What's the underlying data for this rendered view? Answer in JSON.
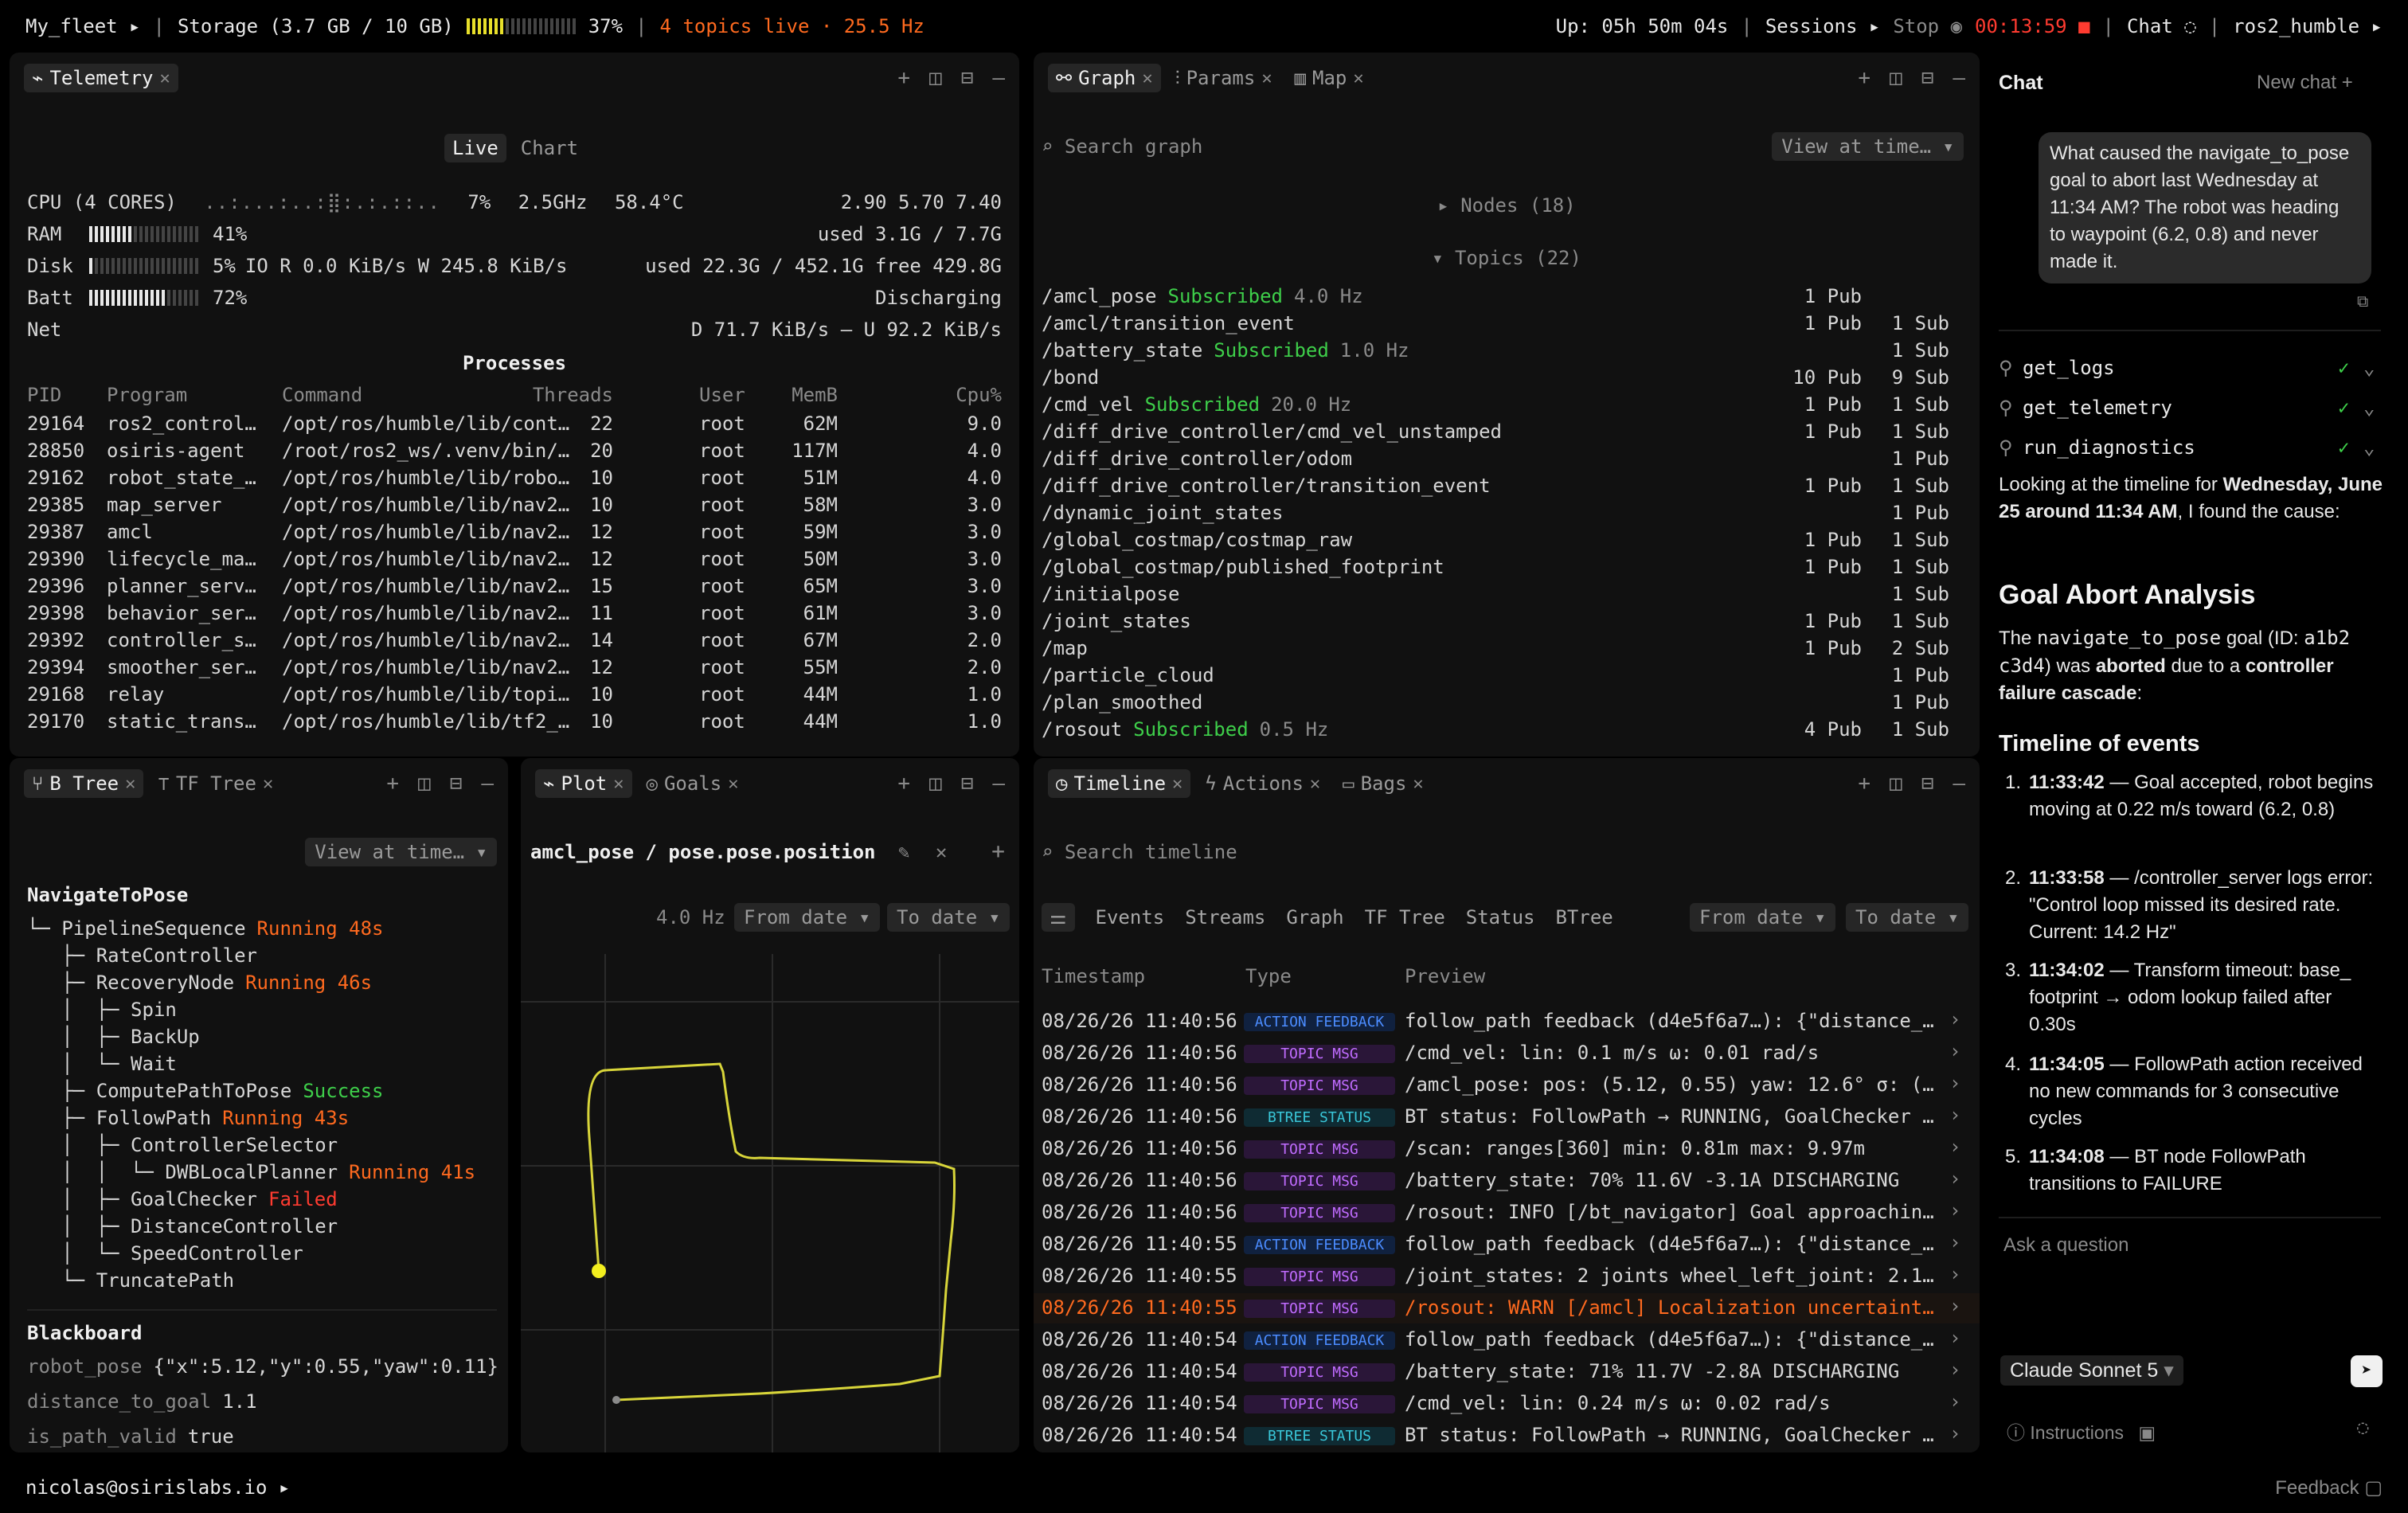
{
  "topbar": {
    "fleet": "My_fleet",
    "storage": "Storage (3.7 GB / 10 GB)",
    "storage_pct": "37%",
    "storage_fraction": 0.37,
    "topics_live": "4 topics live · 25.5 Hz",
    "uptime": "Up: 05h 50m 04s",
    "sessions": "Sessions",
    "stop": "Stop",
    "timer": "00:13:59",
    "chat": "Chat",
    "robot": "ros2_humble"
  },
  "telemetry": {
    "tab": "Telemetry",
    "mode_live": "Live",
    "mode_chart": "Chart",
    "cpu_label": "CPU (4 CORES)",
    "cpu_spark": "..:...:..:⣿:.:.::..",
    "cpu_pct": "7%",
    "cpu_freq": "2.5GHz",
    "cpu_temp": "58.4°C",
    "cpu_load": "2.90 5.70 7.40",
    "ram_label": "RAM",
    "ram_pct": "41%",
    "ram_fraction": 0.41,
    "ram_used": "used 3.1G / 7.7G",
    "disk_label": "Disk",
    "disk_pct": "5%",
    "disk_fraction": 0.05,
    "disk_io": "IO R 0.0 KiB/s W 245.8 KiB/s",
    "disk_used": "used 22.3G / 452.1G free 429.8G",
    "batt_label": "Batt",
    "batt_pct": "72%",
    "batt_fraction": 0.72,
    "batt_state": "Discharging",
    "net_label": "Net",
    "net_rate": "D 71.7 KiB/s — U 92.2 KiB/s",
    "processes_title": "Processes",
    "columns": [
      "PID",
      "Program",
      "Command",
      "Threads",
      "User",
      "MemB",
      "Cpu%"
    ],
    "processes": [
      [
        "29164",
        "ros2_control…",
        "/opt/ros/humble/lib/cont…",
        "22",
        "root",
        "62M",
        "9.0"
      ],
      [
        "28850",
        "osiris-agent",
        "/root/ros2_ws/.venv/bin/…",
        "20",
        "root",
        "117M",
        "4.0"
      ],
      [
        "29162",
        "robot_state_…",
        "/opt/ros/humble/lib/robo…",
        "10",
        "root",
        "51M",
        "4.0"
      ],
      [
        "29385",
        "map_server",
        "/opt/ros/humble/lib/nav2…",
        "10",
        "root",
        "58M",
        "3.0"
      ],
      [
        "29387",
        "amcl",
        "/opt/ros/humble/lib/nav2…",
        "12",
        "root",
        "59M",
        "3.0"
      ],
      [
        "29390",
        "lifecycle_ma…",
        "/opt/ros/humble/lib/nav2…",
        "12",
        "root",
        "50M",
        "3.0"
      ],
      [
        "29396",
        "planner_serv…",
        "/opt/ros/humble/lib/nav2…",
        "15",
        "root",
        "65M",
        "3.0"
      ],
      [
        "29398",
        "behavior_ser…",
        "/opt/ros/humble/lib/nav2…",
        "11",
        "root",
        "61M",
        "3.0"
      ],
      [
        "29392",
        "controller_s…",
        "/opt/ros/humble/lib/nav2…",
        "14",
        "root",
        "67M",
        "2.0"
      ],
      [
        "29394",
        "smoother_ser…",
        "/opt/ros/humble/lib/nav2…",
        "12",
        "root",
        "55M",
        "2.0"
      ],
      [
        "29168",
        "relay",
        "/opt/ros/humble/lib/topi…",
        "10",
        "root",
        "44M",
        "1.0"
      ],
      [
        "29170",
        "static_trans…",
        "/opt/ros/humble/lib/tf2_…",
        "10",
        "root",
        "44M",
        "1.0"
      ]
    ]
  },
  "graph": {
    "tabs": [
      "Graph",
      "Params",
      "Map"
    ],
    "search_placeholder": "Search graph",
    "view_at_time": "View at time…",
    "nodes": "Nodes (18)",
    "topics": "Topics (22)",
    "topic_rows": [
      {
        "name": "/amcl_pose",
        "status": "Subscribed",
        "hz": "4.0 Hz",
        "pub": "1 Pub",
        "sub": ""
      },
      {
        "name": "/amcl/transition_event",
        "status": "",
        "hz": "",
        "pub": "1 Pub",
        "sub": "1 Sub"
      },
      {
        "name": "/battery_state",
        "status": "Subscribed",
        "hz": "1.0 Hz",
        "pub": "",
        "sub": "1 Sub"
      },
      {
        "name": "/bond",
        "status": "",
        "hz": "",
        "pub": "10 Pub",
        "sub": "9 Sub"
      },
      {
        "name": "/cmd_vel",
        "status": "Subscribed",
        "hz": "20.0 Hz",
        "pub": "1 Pub",
        "sub": "1 Sub"
      },
      {
        "name": "/diff_drive_controller/cmd_vel_unstamped",
        "status": "",
        "hz": "",
        "pub": "1 Pub",
        "sub": "1 Sub"
      },
      {
        "name": "/diff_drive_controller/odom",
        "status": "",
        "hz": "",
        "pub": "",
        "sub": "1 Pub"
      },
      {
        "name": "/diff_drive_controller/transition_event",
        "status": "",
        "hz": "",
        "pub": "1 Pub",
        "sub": "1 Sub"
      },
      {
        "name": "/dynamic_joint_states",
        "status": "",
        "hz": "",
        "pub": "",
        "sub": "1 Pub"
      },
      {
        "name": "/global_costmap/costmap_raw",
        "status": "",
        "hz": "",
        "pub": "1 Pub",
        "sub": "1 Sub"
      },
      {
        "name": "/global_costmap/published_footprint",
        "status": "",
        "hz": "",
        "pub": "1 Pub",
        "sub": "1 Sub"
      },
      {
        "name": "/initialpose",
        "status": "",
        "hz": "",
        "pub": "",
        "sub": "1 Sub"
      },
      {
        "name": "/joint_states",
        "status": "",
        "hz": "",
        "pub": "1 Pub",
        "sub": "1 Sub"
      },
      {
        "name": "/map",
        "status": "",
        "hz": "",
        "pub": "1 Pub",
        "sub": "2 Sub"
      },
      {
        "name": "/particle_cloud",
        "status": "",
        "hz": "",
        "pub": "",
        "sub": "1 Pub"
      },
      {
        "name": "/plan_smoothed",
        "status": "",
        "hz": "",
        "pub": "",
        "sub": "1 Pub"
      },
      {
        "name": "/rosout",
        "status": "Subscribed",
        "hz": "0.5 Hz",
        "pub": "4 Pub",
        "sub": "1 Sub"
      }
    ]
  },
  "btree": {
    "tabs": [
      "B Tree",
      "TF Tree"
    ],
    "view_at_time": "View at time…",
    "root": "NavigateToPose",
    "lines": [
      {
        "prefix": "└─ ",
        "name": "PipelineSequence",
        "status": "Running 48s",
        "kind": "running"
      },
      {
        "prefix": "   ├─ ",
        "name": "RateController",
        "status": "",
        "kind": ""
      },
      {
        "prefix": "   ├─ ",
        "name": "RecoveryNode",
        "status": "Running 46s",
        "kind": "running"
      },
      {
        "prefix": "   │  ├─ ",
        "name": "Spin",
        "status": "",
        "kind": ""
      },
      {
        "prefix": "   │  ├─ ",
        "name": "BackUp",
        "status": "",
        "kind": ""
      },
      {
        "prefix": "   │  └─ ",
        "name": "Wait",
        "status": "",
        "kind": ""
      },
      {
        "prefix": "   ├─ ",
        "name": "ComputePathToPose",
        "status": "Success",
        "kind": "success"
      },
      {
        "prefix": "   ├─ ",
        "name": "FollowPath",
        "status": "Running 43s",
        "kind": "running"
      },
      {
        "prefix": "   │  ├─ ",
        "name": "ControllerSelector",
        "status": "",
        "kind": ""
      },
      {
        "prefix": "   │  │  └─ ",
        "name": "DWBLocalPlanner",
        "status": "Running 41s",
        "kind": "running"
      },
      {
        "prefix": "   │  ├─ ",
        "name": "GoalChecker",
        "status": "Failed",
        "kind": "failed"
      },
      {
        "prefix": "   │  ├─ ",
        "name": "DistanceController",
        "status": "",
        "kind": ""
      },
      {
        "prefix": "   │  └─ ",
        "name": "SpeedController",
        "status": "",
        "kind": ""
      },
      {
        "prefix": "   └─ ",
        "name": "TruncatePath",
        "status": "",
        "kind": ""
      }
    ],
    "blackboard_title": "Blackboard",
    "blackboard": [
      {
        "key": "robot_pose",
        "val": "{\"x\":5.12,\"y\":0.55,\"yaw\":0.11}"
      },
      {
        "key": "distance_to_goal",
        "val": "1.1"
      },
      {
        "key": "is_path_valid",
        "val": "true"
      }
    ]
  },
  "plot": {
    "tabs": [
      "Plot",
      "Goals"
    ],
    "title": "amcl_pose / pose.pose.position",
    "hz": "4.0 Hz",
    "from_date": "From date",
    "to_date": "To date"
  },
  "timeline": {
    "tabs": [
      "Timeline",
      "Actions",
      "Bags"
    ],
    "search_placeholder": "Search timeline",
    "filters": [
      "Events",
      "Streams",
      "Graph",
      "TF Tree",
      "Status",
      "BTree"
    ],
    "from_date": "From date",
    "to_date": "To date",
    "columns": [
      "Timestamp",
      "Type",
      "Preview"
    ],
    "rows": [
      {
        "ts": "08/26/26 11:40:56",
        "type": "ACTION FEEDBACK",
        "kind": "af",
        "preview": "follow_path feedback (d4e5f6a7…): {\"distance_…",
        "warn": false
      },
      {
        "ts": "08/26/26 11:40:56",
        "type": "TOPIC MSG",
        "kind": "tm",
        "preview": "/cmd_vel: lin: 0.1 m/s ω: 0.01 rad/s",
        "warn": false
      },
      {
        "ts": "08/26/26 11:40:56",
        "type": "TOPIC MSG",
        "kind": "tm",
        "preview": "/amcl_pose: pos: (5.12, 0.55) yaw: 12.6° σ: (…",
        "warn": false
      },
      {
        "ts": "08/26/26 11:40:56",
        "type": "BTREE STATUS",
        "kind": "bs",
        "preview": "BT status: FollowPath → RUNNING, GoalChecker …",
        "warn": false
      },
      {
        "ts": "08/26/26 11:40:56",
        "type": "TOPIC MSG",
        "kind": "tm",
        "preview": "/scan: ranges[360] min: 0.81m max: 9.97m",
        "warn": false
      },
      {
        "ts": "08/26/26 11:40:56",
        "type": "TOPIC MSG",
        "kind": "tm",
        "preview": "/battery_state: 70% 11.6V -3.1A DISCHARGING",
        "warn": false
      },
      {
        "ts": "08/26/26 11:40:56",
        "type": "TOPIC MSG",
        "kind": "tm",
        "preview": "/rosout: INFO [/bt_navigator] Goal approachin…",
        "warn": false
      },
      {
        "ts": "08/26/26 11:40:55",
        "type": "ACTION FEEDBACK",
        "kind": "af",
        "preview": "follow_path feedback (d4e5f6a7…): {\"distance_…",
        "warn": false
      },
      {
        "ts": "08/26/26 11:40:55",
        "type": "TOPIC MSG",
        "kind": "tm",
        "preview": "/joint_states: 2 joints wheel_left_joint: 2.1…",
        "warn": false
      },
      {
        "ts": "08/26/26 11:40:55",
        "type": "TOPIC MSG",
        "kind": "tm",
        "preview": "/rosout: WARN [/amcl] Localization uncertaint…",
        "warn": true
      },
      {
        "ts": "08/26/26 11:40:54",
        "type": "ACTION FEEDBACK",
        "kind": "af",
        "preview": "follow_path feedback (d4e5f6a7…): {\"distance_…",
        "warn": false
      },
      {
        "ts": "08/26/26 11:40:54",
        "type": "TOPIC MSG",
        "kind": "tm",
        "preview": "/battery_state: 71% 11.7V -2.8A DISCHARGING",
        "warn": false
      },
      {
        "ts": "08/26/26 11:40:54",
        "type": "TOPIC MSG",
        "kind": "tm",
        "preview": "/cmd_vel: lin: 0.24 m/s ω: 0.02 rad/s",
        "warn": false
      },
      {
        "ts": "08/26/26 11:40:54",
        "type": "BTREE STATUS",
        "kind": "bs",
        "preview": "BT status: FollowPath → RUNNING, GoalChecker …",
        "warn": false
      }
    ]
  },
  "chat": {
    "title": "Chat",
    "new_chat": "New chat",
    "user_message": "What caused the navigate_to_pose goal to abort last Wednesday at 11:34 AM? The robot was heading to waypoint (6.2, 0.8) and never made it.",
    "tools": [
      "get_logs",
      "get_telemetry",
      "run_diagnostics"
    ],
    "intro_a": "Looking at the timeline for ",
    "intro_b": "Wednesday, June 25 around 11:34 AM",
    "intro_c": ", I found the cause:",
    "heading": "Goal Abort Analysis",
    "summary_a": "The ",
    "summary_code1": "navigate_to_pose",
    "summary_b": " goal (ID: ",
    "summary_code2": "a1b2 c3d4",
    "summary_c": ") was ",
    "summary_d": "aborted",
    "summary_e": " due to a ",
    "summary_f": "controller failure cascade",
    "summary_g": ":",
    "timeline_heading": "Timeline of events",
    "events": [
      {
        "n": "1.",
        "t": "11:33:42",
        "text": " — Goal accepted, robot begins moving at 0.22 m/s toward (6.2, 0.8)"
      },
      {
        "n": "2.",
        "t": "11:33:58",
        "text": " — /controller_server logs error: \"Control loop missed its desired rate. Current: 14.2 Hz\""
      },
      {
        "n": "3.",
        "t": "11:34:02",
        "text": " — Transform timeout: base_ footprint → odom lookup failed after 0.30s"
      },
      {
        "n": "4.",
        "t": "11:34:05",
        "text": " — FollowPath action received no new commands for 3 consecutive cycles"
      },
      {
        "n": "5.",
        "t": "11:34:08",
        "text": " — BT node FollowPath transitions to FAILURE"
      }
    ],
    "input_placeholder": "Ask a question",
    "model": "Claude Sonnet 5",
    "instructions": "Instructions"
  },
  "bottombar": {
    "user": "nicolas@osirislabs.io",
    "feedback": "Feedback"
  },
  "colors": {
    "accent_yellow": "#e8e02a",
    "running": "#ff6a1f",
    "success": "#3ecf4a",
    "failed": "#ff3b30"
  }
}
